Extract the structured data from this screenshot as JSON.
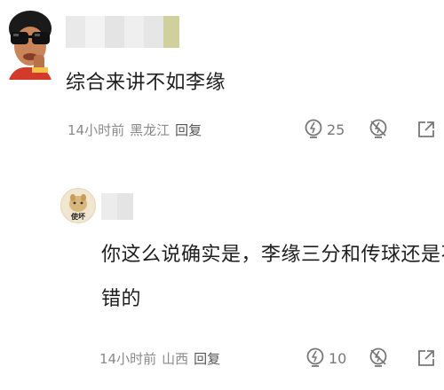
{
  "comments": [
    {
      "text": "综合来讲不如李缘",
      "time": "14小时前",
      "location": "黑龙江",
      "reply_label": "回复",
      "likes": "25"
    },
    {
      "avatar_text": "使坏",
      "text_line1": "你这么说确实是，李缘三分和传球还是不",
      "text_line2": "错的",
      "time": "14小时前",
      "location": "山西",
      "reply_label": "回复",
      "likes": "10"
    }
  ],
  "icons": {
    "like": "lightbulb-icon",
    "dislike": "lightbulb-off-icon",
    "share": "share-icon"
  },
  "colors": {
    "meta_text": "#8a8a8a",
    "body_text": "#1e1e1e",
    "icon": "#777777"
  }
}
